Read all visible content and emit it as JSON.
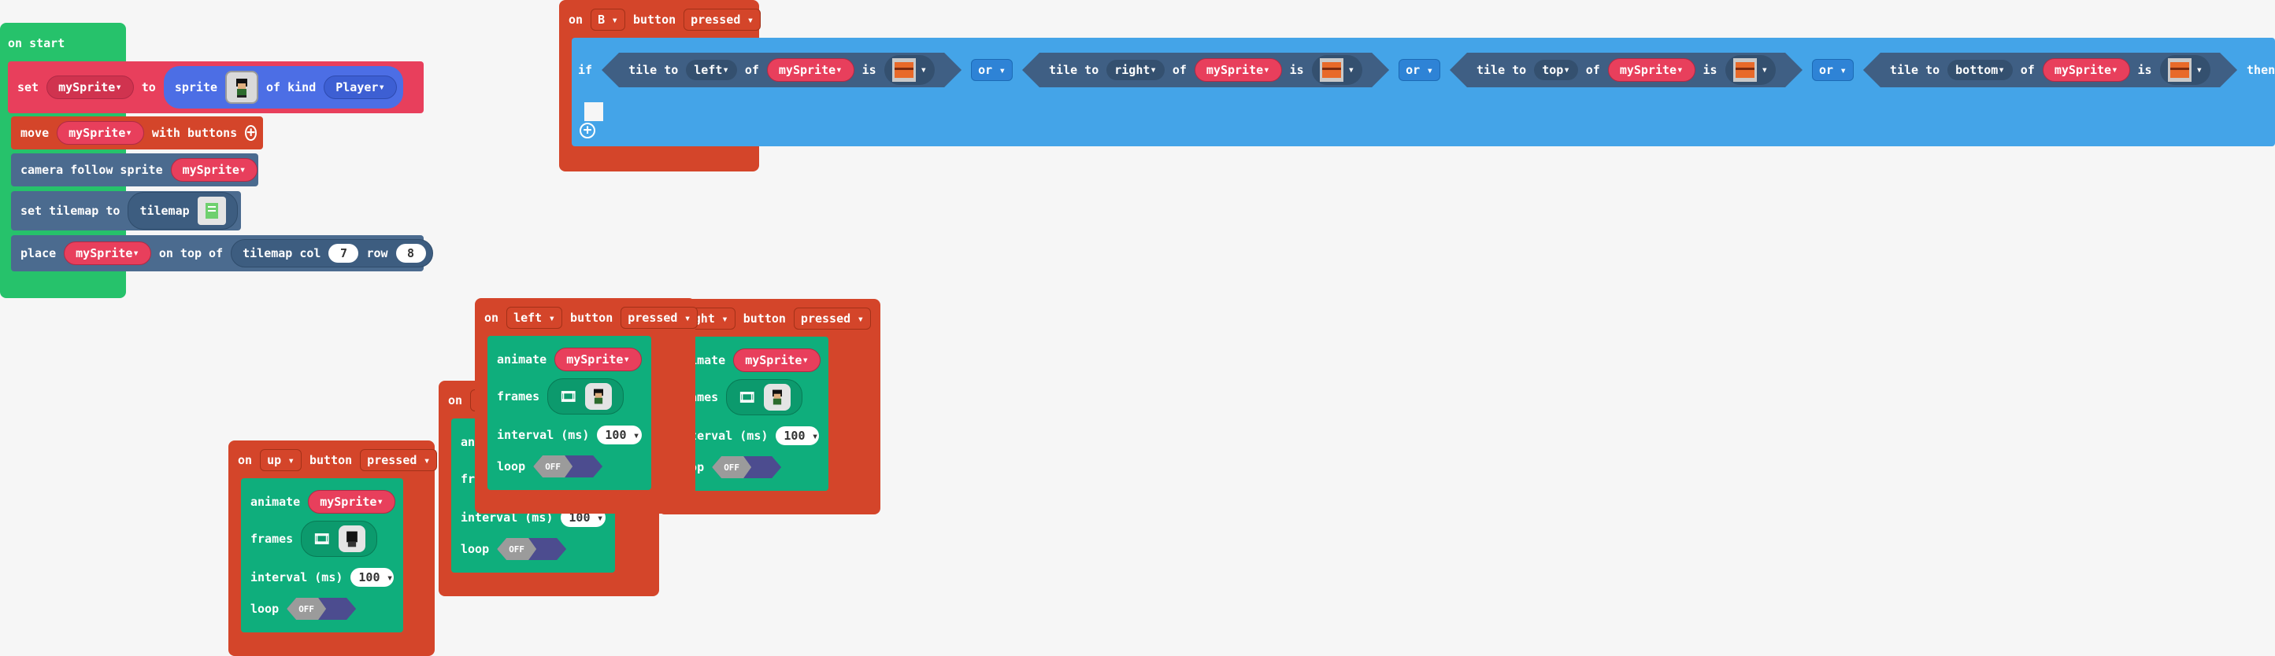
{
  "on_start": {
    "title": "on start",
    "set_kw": "set",
    "set_var": "mySprite",
    "to_kw": "to",
    "sprite_kw": "sprite",
    "of_kind_kw": "of kind",
    "kind": "Player",
    "move_kw": "move",
    "move_var": "mySprite",
    "with_buttons": "with buttons",
    "camera_follow": "camera follow sprite",
    "camera_var": "mySprite",
    "set_tilemap": "set tilemap to",
    "tilemap_kw": "tilemap",
    "place_kw": "place",
    "place_var": "mySprite",
    "on_top_of": "on top of",
    "tilemap_col": "tilemap col",
    "col": "7",
    "row_kw": "row",
    "row": "8"
  },
  "b_event": {
    "on": "on",
    "button": "B",
    "button_kw": "button",
    "action": "pressed",
    "if_kw": "if",
    "then_kw": "then",
    "conditions": [
      {
        "tile_to": "tile to",
        "dir": "left",
        "of": "of",
        "var": "mySprite",
        "is": "is"
      },
      {
        "tile_to": "tile to",
        "dir": "right",
        "of": "of",
        "var": "mySprite",
        "is": "is"
      },
      {
        "tile_to": "tile to",
        "dir": "top",
        "of": "of",
        "var": "mySprite",
        "is": "is"
      },
      {
        "tile_to": "tile to",
        "dir": "bottom",
        "of": "of",
        "var": "mySprite",
        "is": "is"
      }
    ],
    "or_kw": "or"
  },
  "anim_common": {
    "animate": "animate",
    "var": "mySprite",
    "frames": "frames",
    "interval": "interval (ms)",
    "interval_value": "100",
    "loop": "loop",
    "loop_state": "OFF"
  },
  "left_event": {
    "on": "on",
    "button": "left",
    "button_kw": "button",
    "action": "pressed"
  },
  "right_event": {
    "partial": "ight",
    "button_kw": "button",
    "action": "pressed"
  },
  "up_event": {
    "on": "on",
    "button": "up",
    "button_kw": "button",
    "action": "pressed"
  },
  "down_event": {
    "on": "on",
    "partial": "a",
    "partial2": "ani",
    "partial3": "fra"
  },
  "colors": {
    "events": "#d4452a",
    "sprites": "#e83f5c",
    "scene": "#4b6b8f",
    "animation": "#0fae7c",
    "logic": "#44a4e8",
    "start": "#26c26b"
  }
}
